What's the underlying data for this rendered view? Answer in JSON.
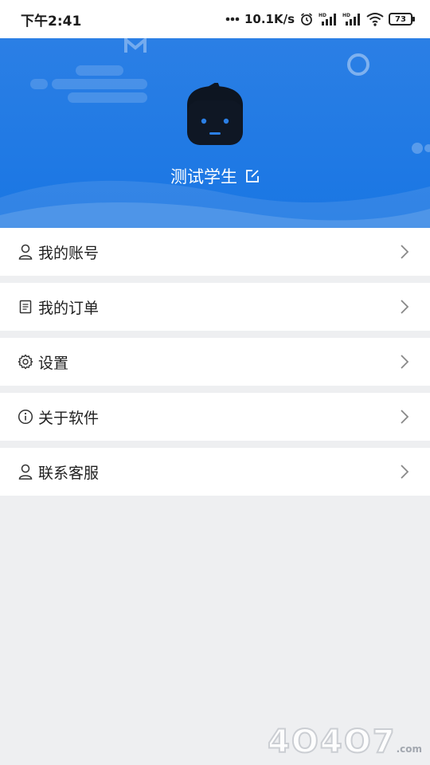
{
  "status_bar": {
    "time": "下午2:41",
    "network_speed": "10.1K/s",
    "battery": "73",
    "icons": [
      "dots-icon",
      "alarm-icon",
      "hd-signal-icon",
      "hd-signal-icon",
      "wifi-icon",
      "battery-icon"
    ]
  },
  "profile": {
    "username": "测试学生",
    "avatar_icon": "cartoon-face-avatar",
    "edit_icon": "edit-icon",
    "accent_color": "#1976e3"
  },
  "menu": {
    "items": [
      {
        "label": "我的账号",
        "icon": "person-icon"
      },
      {
        "label": "我的订单",
        "icon": "document-icon"
      },
      {
        "label": "设置",
        "icon": "gear-icon"
      },
      {
        "label": "关于软件",
        "icon": "info-icon"
      },
      {
        "label": "联系客服",
        "icon": "person-icon"
      }
    ],
    "chevron_icon": "chevron-right-icon"
  },
  "watermark": {
    "text": "4O4O7",
    "suffix": ".com"
  }
}
